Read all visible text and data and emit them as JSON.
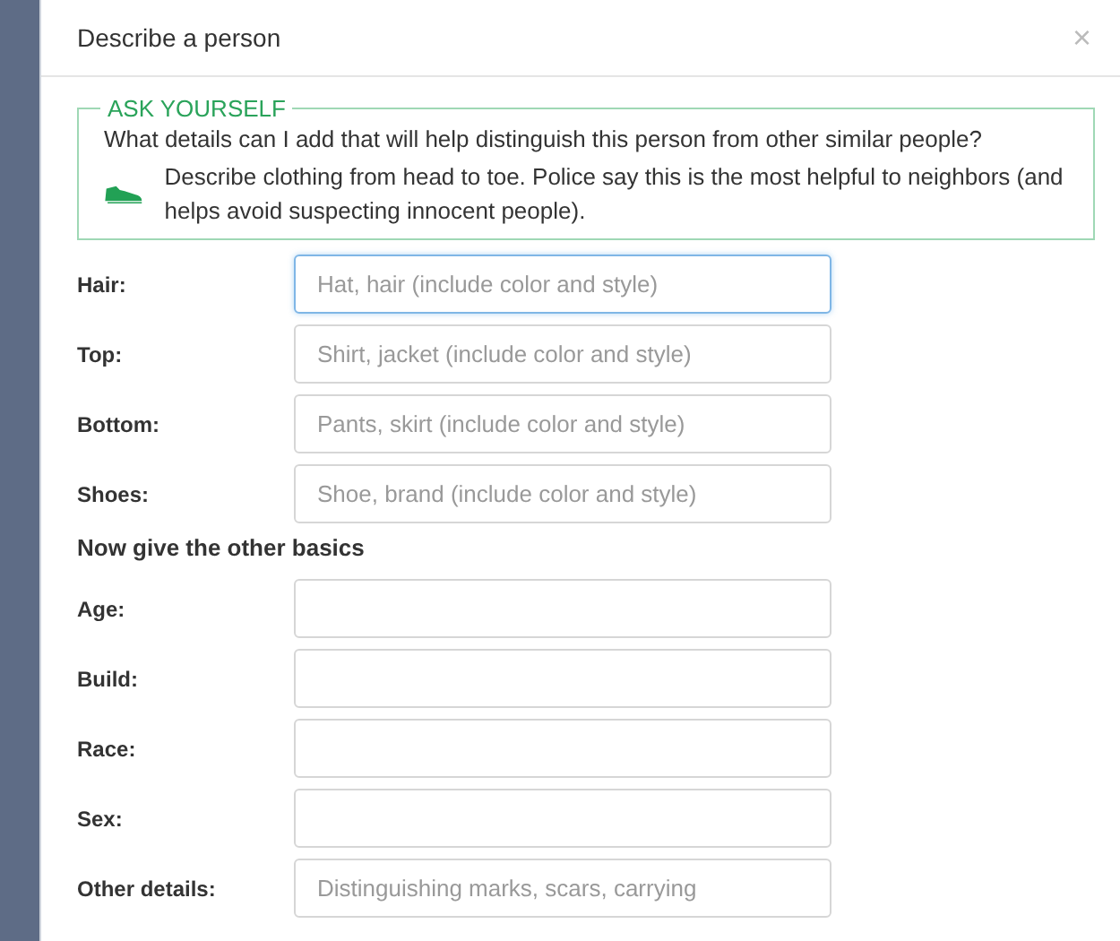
{
  "dialog": {
    "title": "Describe a person",
    "close": "×",
    "ask_yourself": {
      "legend": "ASK YOURSELF",
      "question": "What details can I add that will help distinguish this person from other similar people?",
      "tip": "Describe clothing from head to toe. Police say this is the most helpful to neighbors (and helps avoid suspecting innocent people)."
    },
    "clothing_fields": [
      {
        "label": "Hair:",
        "placeholder": "Hat, hair (include color and style)",
        "focused": true
      },
      {
        "label": "Top:",
        "placeholder": "Shirt, jacket (include color and style)",
        "focused": false
      },
      {
        "label": "Bottom:",
        "placeholder": "Pants, skirt (include color and style)",
        "focused": false
      },
      {
        "label": "Shoes:",
        "placeholder": "Shoe, brand (include color and style)",
        "focused": false
      }
    ],
    "section_heading": "Now give the other basics",
    "basic_fields": [
      {
        "label": "Age:",
        "focused": false
      },
      {
        "label": "Build:",
        "focused": false
      },
      {
        "label": "Race:",
        "focused": false
      },
      {
        "label": "Sex:",
        "focused": false
      },
      {
        "label": "Other details:",
        "placeholder": "Distinguishing marks, scars, carrying",
        "focused": false
      }
    ]
  }
}
